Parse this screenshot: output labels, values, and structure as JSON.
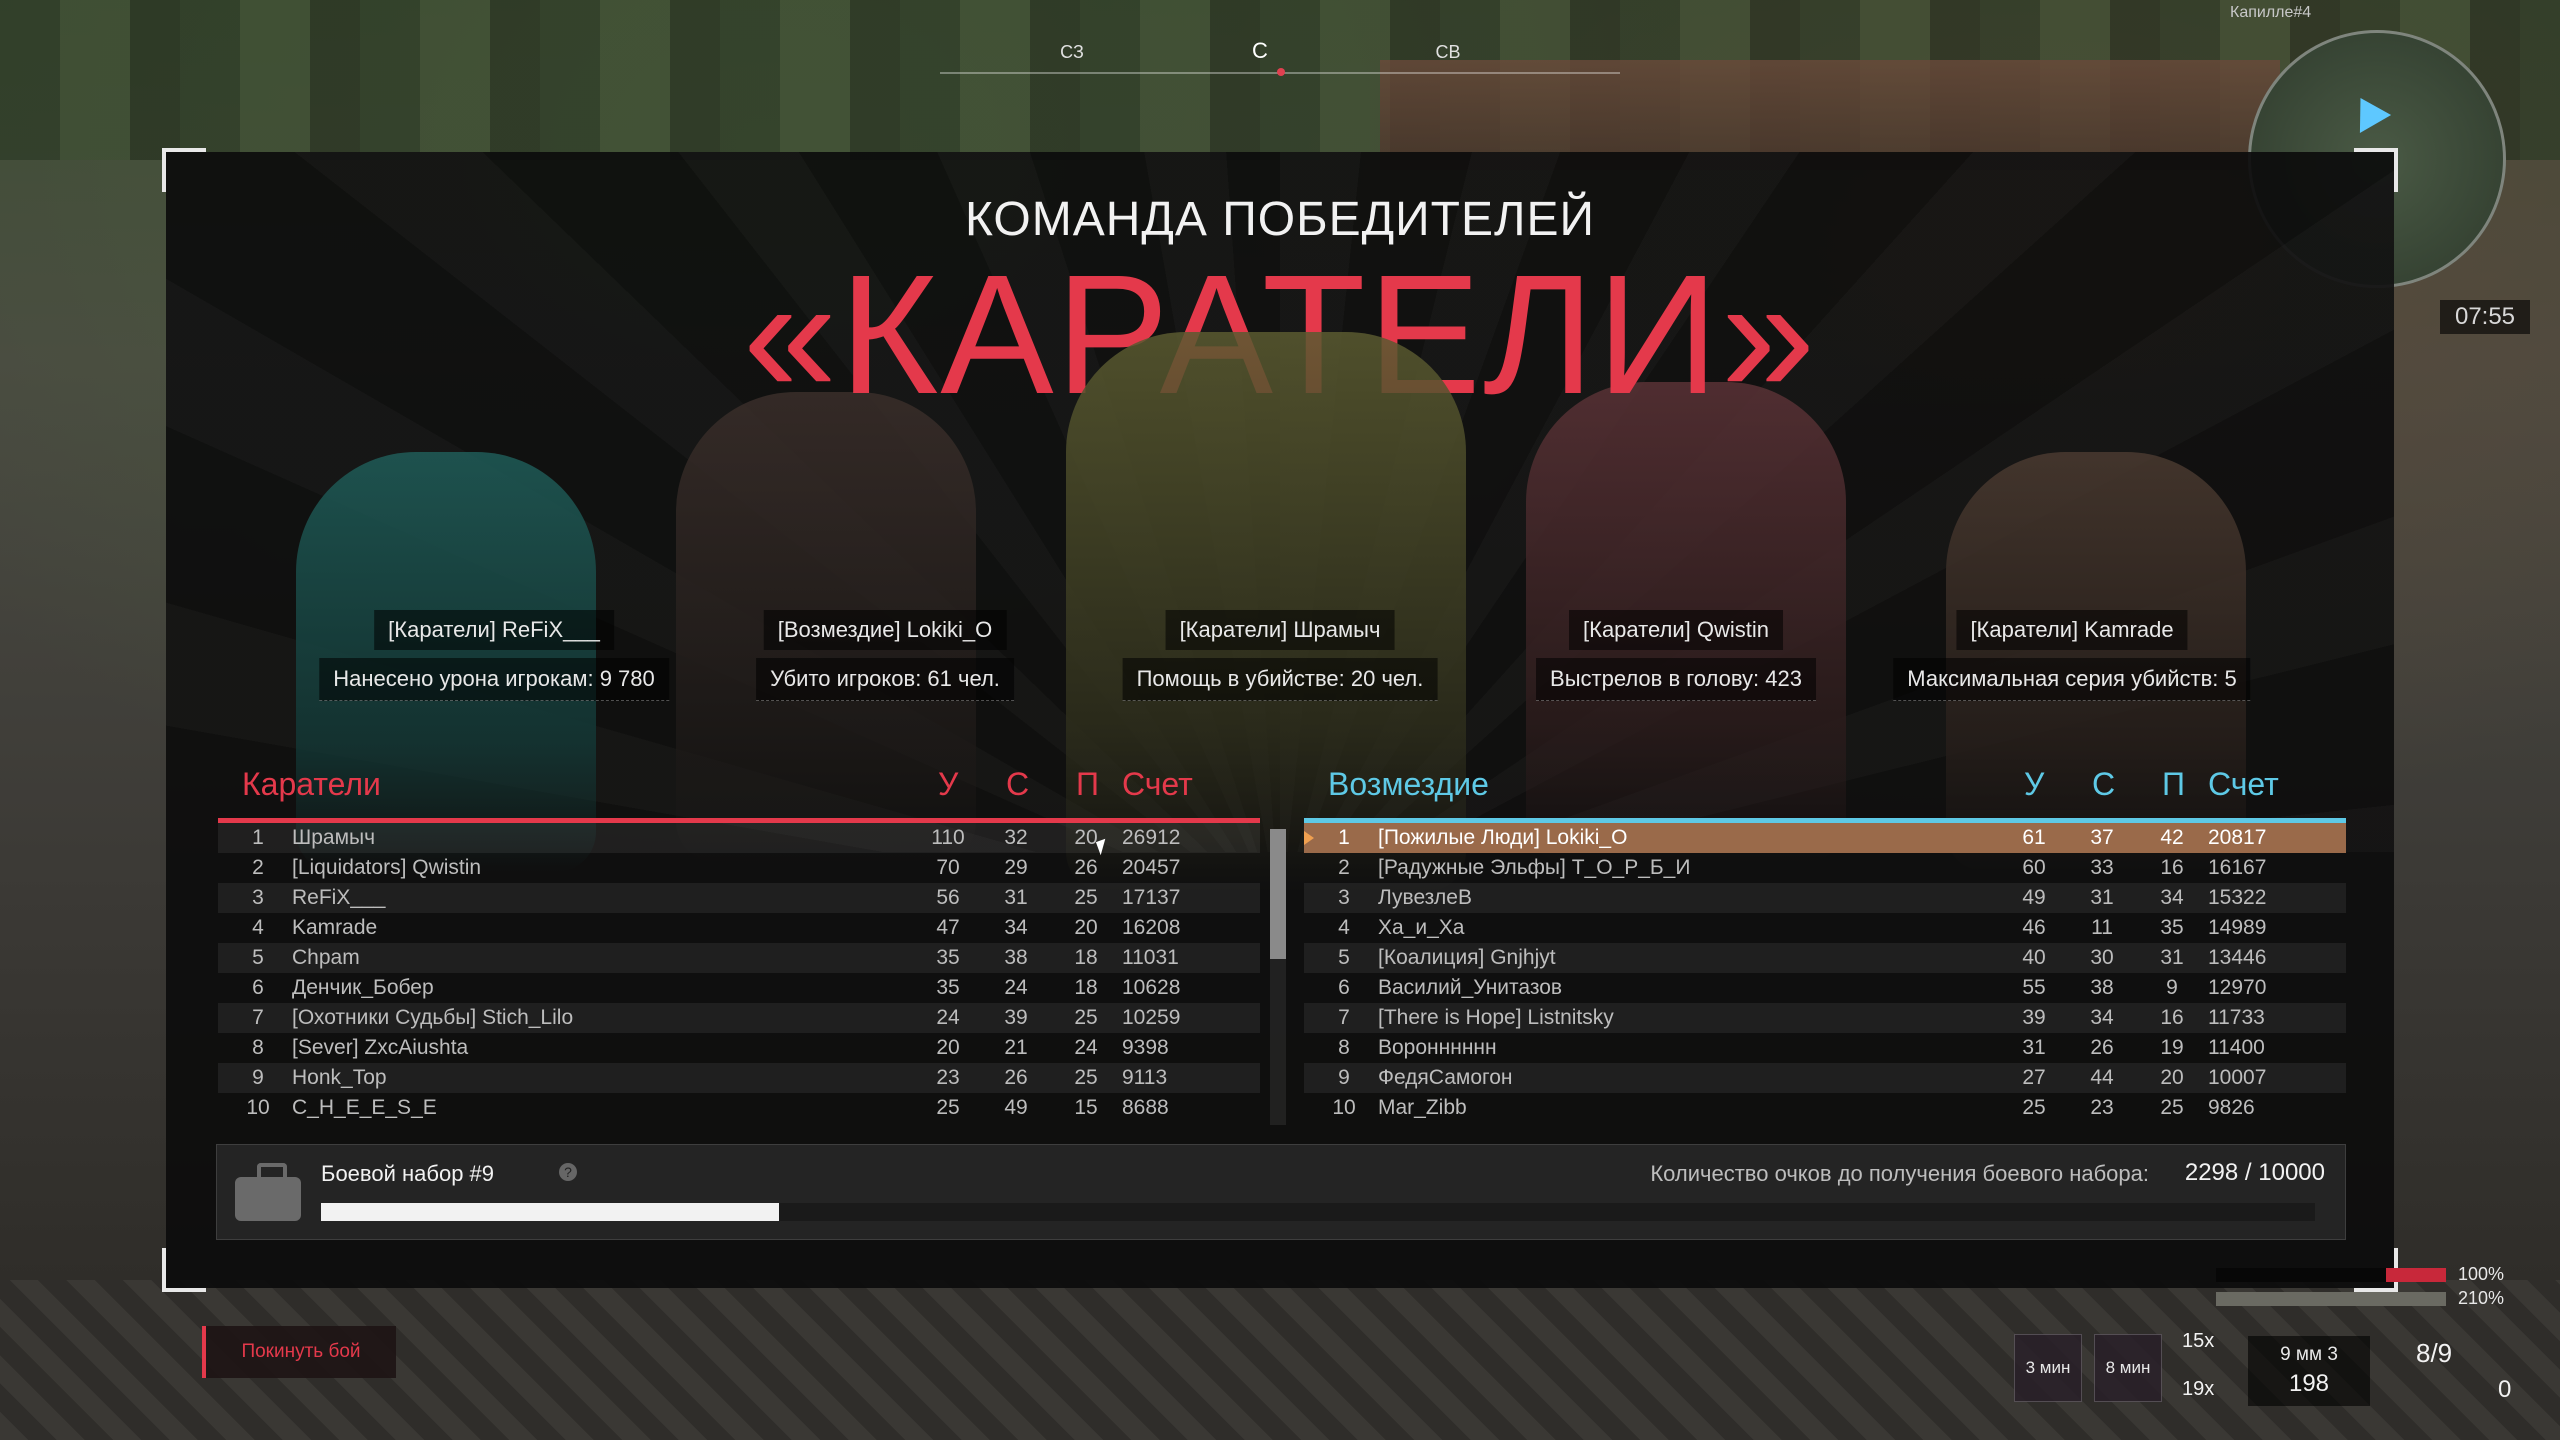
{
  "compass": {
    "marks": [
      "СЗ",
      "С",
      "СВ"
    ]
  },
  "minimap": {
    "label": "Капилле#4",
    "time": "07:55"
  },
  "victory": {
    "subtitle": "КОМАНДА ПОБЕДИТЕЛЕЙ",
    "team": "«КАРАТЕЛИ»"
  },
  "mvps": [
    {
      "name": "[Каратели] ReFiX___",
      "stat": "Нанесено урона игрокам: 9 780"
    },
    {
      "name": "[Возмездие] Lokiki_O",
      "stat": "Убито игроков: 61 чел."
    },
    {
      "name": "[Каратели] Шрамыч",
      "stat": "Помощь в убийстве: 20 чел."
    },
    {
      "name": "[Каратели] Qwistin",
      "stat": "Выстрелов в голову: 423"
    },
    {
      "name": "[Каратели] Kamrade",
      "stat": "Максимальная серия убийств: 5"
    }
  ],
  "columns": {
    "kills": "У",
    "deaths": "С",
    "assists": "П",
    "score": "Счет"
  },
  "teams": {
    "left": {
      "name": "Каратели",
      "color": "#e4394b",
      "rows": [
        {
          "rank": "1",
          "name": "Шрамыч",
          "k": "110",
          "d": "32",
          "a": "20",
          "score": "26912"
        },
        {
          "rank": "2",
          "name": "[Liquidators] Qwistin",
          "k": "70",
          "d": "29",
          "a": "26",
          "score": "20457"
        },
        {
          "rank": "3",
          "name": "ReFiX___",
          "k": "56",
          "d": "31",
          "a": "25",
          "score": "17137"
        },
        {
          "rank": "4",
          "name": "Kamrade",
          "k": "47",
          "d": "34",
          "a": "20",
          "score": "16208"
        },
        {
          "rank": "5",
          "name": "Chpam",
          "k": "35",
          "d": "38",
          "a": "18",
          "score": "11031"
        },
        {
          "rank": "6",
          "name": "Денчик_Бобер",
          "k": "35",
          "d": "24",
          "a": "18",
          "score": "10628"
        },
        {
          "rank": "7",
          "name": "[Охотники Судьбы] Stich_Lilo",
          "k": "24",
          "d": "39",
          "a": "25",
          "score": "10259"
        },
        {
          "rank": "8",
          "name": "[Sever] ZxcAiushta",
          "k": "20",
          "d": "21",
          "a": "24",
          "score": "9398"
        },
        {
          "rank": "9",
          "name": "Honk_Top",
          "k": "23",
          "d": "26",
          "a": "25",
          "score": "9113"
        },
        {
          "rank": "10",
          "name": "C_H_E_E_S_E",
          "k": "25",
          "d": "49",
          "a": "15",
          "score": "8688"
        }
      ]
    },
    "right": {
      "name": "Возмездие",
      "color": "#5ec9e6",
      "rows": [
        {
          "rank": "1",
          "name": "[Пожилые Люди] Lokiki_O",
          "k": "61",
          "d": "37",
          "a": "42",
          "score": "20817",
          "self": true
        },
        {
          "rank": "2",
          "name": "[Радужные Эльфы] Т_О_Р_Б_И",
          "k": "60",
          "d": "33",
          "a": "16",
          "score": "16167"
        },
        {
          "rank": "3",
          "name": "ЛувезлеВ",
          "k": "49",
          "d": "31",
          "a": "34",
          "score": "15322"
        },
        {
          "rank": "4",
          "name": "Ха_и_Ха",
          "k": "46",
          "d": "11",
          "a": "35",
          "score": "14989"
        },
        {
          "rank": "5",
          "name": "[Коалиция] Gnjhjyt",
          "k": "40",
          "d": "30",
          "a": "31",
          "score": "13446"
        },
        {
          "rank": "6",
          "name": "Василий_Унитазов",
          "k": "55",
          "d": "38",
          "a": "9",
          "score": "12970"
        },
        {
          "rank": "7",
          "name": "[There is Hope] Listnitsky",
          "k": "39",
          "d": "34",
          "a": "16",
          "score": "11733"
        },
        {
          "rank": "8",
          "name": "Воронннннн",
          "k": "31",
          "d": "26",
          "a": "19",
          "score": "11400"
        },
        {
          "rank": "9",
          "name": "ФедяСамогон",
          "k": "27",
          "d": "44",
          "a": "20",
          "score": "10007"
        },
        {
          "rank": "10",
          "name": "Mar_Zibb",
          "k": "25",
          "d": "23",
          "a": "25",
          "score": "9826"
        }
      ]
    }
  },
  "battle_kit": {
    "title": "Боевой набор #9",
    "help": "?",
    "progress_label": "Количество очков до получения боевого набора:",
    "progress_value": "2298 / 10000",
    "progress_fraction": 0.2298
  },
  "leave_button": "Покинуть бой",
  "hud": {
    "health_pct": "100%",
    "armor_pct": "210%",
    "boost1": "3 мин",
    "boost2": "8 мин",
    "medkit_count": "15x",
    "bandage_count": "19x",
    "ammo_type": "9 мм 3",
    "ammo_count": "198",
    "magazine": "8/9",
    "grenades": "0"
  }
}
